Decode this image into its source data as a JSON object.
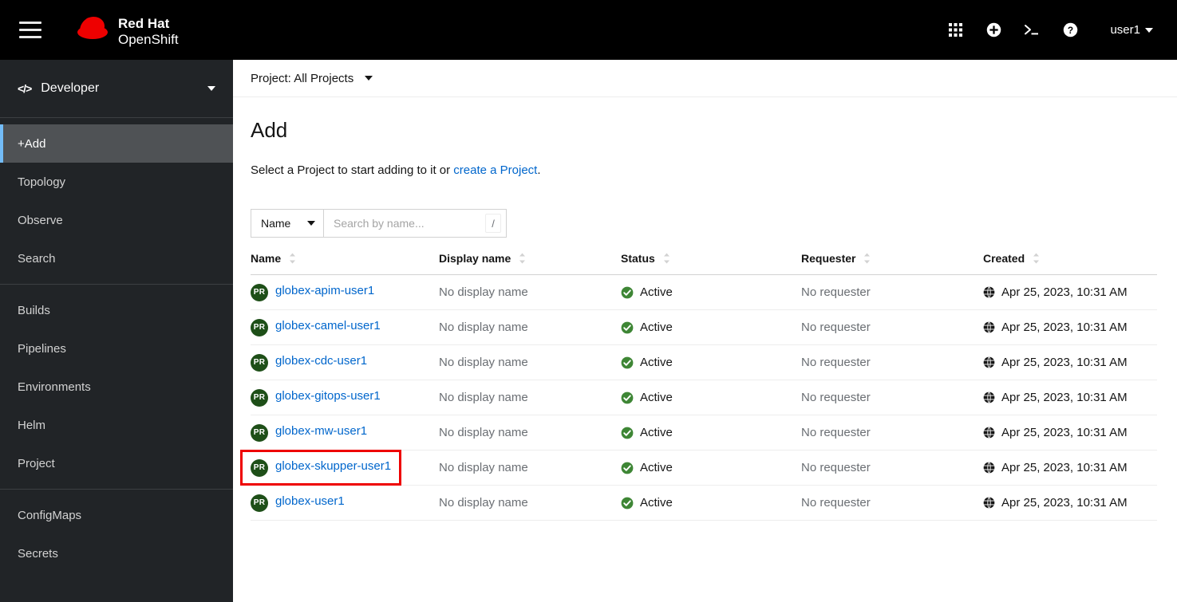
{
  "masthead": {
    "menu_icon": "hamburger-icon",
    "brand": "Red Hat OpenShift",
    "brand_line1": "Red Hat",
    "brand_line2": "OpenShift",
    "tools": [
      {
        "name": "app-launcher-icon",
        "label": "Application launcher"
      },
      {
        "name": "plus-circle-icon",
        "label": "Quick create"
      },
      {
        "name": "terminal-icon",
        "label": "Cloud shell"
      },
      {
        "name": "help-icon",
        "label": "Help"
      }
    ],
    "user": "user1"
  },
  "sidebar": {
    "perspective": {
      "label": "Developer",
      "icon": "code-icon"
    },
    "groups": [
      {
        "items": [
          {
            "label": "+Add",
            "active": true
          },
          {
            "label": "Topology",
            "active": false
          },
          {
            "label": "Observe",
            "active": false
          },
          {
            "label": "Search",
            "active": false
          }
        ]
      },
      {
        "items": [
          {
            "label": "Builds",
            "active": false
          },
          {
            "label": "Pipelines",
            "active": false
          },
          {
            "label": "Environments",
            "active": false
          },
          {
            "label": "Helm",
            "active": false
          },
          {
            "label": "Project",
            "active": false
          }
        ]
      },
      {
        "items": [
          {
            "label": "ConfigMaps",
            "active": false
          },
          {
            "label": "Secrets",
            "active": false
          }
        ]
      }
    ]
  },
  "project_bar": {
    "label": "Project: All Projects"
  },
  "page": {
    "title": "Add",
    "description_prefix": "Select a Project to start adding to it or ",
    "description_link": "create a Project",
    "description_suffix": "."
  },
  "toolbar": {
    "filter_label": "Name",
    "search_placeholder": "Search by name...",
    "search_value": "",
    "shortcut_key": "/"
  },
  "table": {
    "columns": [
      {
        "label": "Name",
        "sortable": true
      },
      {
        "label": "Display name",
        "sortable": true
      },
      {
        "label": "Status",
        "sortable": true
      },
      {
        "label": "Requester",
        "sortable": true
      },
      {
        "label": "Created",
        "sortable": true
      }
    ],
    "rows": [
      {
        "badge": "PR",
        "name": "globex-apim-user1",
        "display_name": "No display name",
        "status": "Active",
        "requester": "No requester",
        "created": "Apr 25, 2023, 10:31 AM",
        "highlighted": false
      },
      {
        "badge": "PR",
        "name": "globex-camel-user1",
        "display_name": "No display name",
        "status": "Active",
        "requester": "No requester",
        "created": "Apr 25, 2023, 10:31 AM",
        "highlighted": false
      },
      {
        "badge": "PR",
        "name": "globex-cdc-user1",
        "display_name": "No display name",
        "status": "Active",
        "requester": "No requester",
        "created": "Apr 25, 2023, 10:31 AM",
        "highlighted": false
      },
      {
        "badge": "PR",
        "name": "globex-gitops-user1",
        "display_name": "No display name",
        "status": "Active",
        "requester": "No requester",
        "created": "Apr 25, 2023, 10:31 AM",
        "highlighted": false
      },
      {
        "badge": "PR",
        "name": "globex-mw-user1",
        "display_name": "No display name",
        "status": "Active",
        "requester": "No requester",
        "created": "Apr 25, 2023, 10:31 AM",
        "highlighted": false
      },
      {
        "badge": "PR",
        "name": "globex-skupper-user1",
        "display_name": "No display name",
        "status": "Active",
        "requester": "No requester",
        "created": "Apr 25, 2023, 10:31 AM",
        "highlighted": true
      },
      {
        "badge": "PR",
        "name": "globex-user1",
        "display_name": "No display name",
        "status": "Active",
        "requester": "No requester",
        "created": "Apr 25, 2023, 10:31 AM",
        "highlighted": false
      }
    ]
  },
  "colors": {
    "masthead_bg": "#000000",
    "sidebar_bg": "#212427",
    "sidebar_active_bg": "#4f5255",
    "sidebar_accent": "#73bcf7",
    "link": "#0066cc",
    "status_green": "#3e8635",
    "badge_green": "#1e4f18",
    "brand_red": "#ee0000",
    "annotation_red": "#ee0000",
    "muted_text": "#6a6e73"
  }
}
